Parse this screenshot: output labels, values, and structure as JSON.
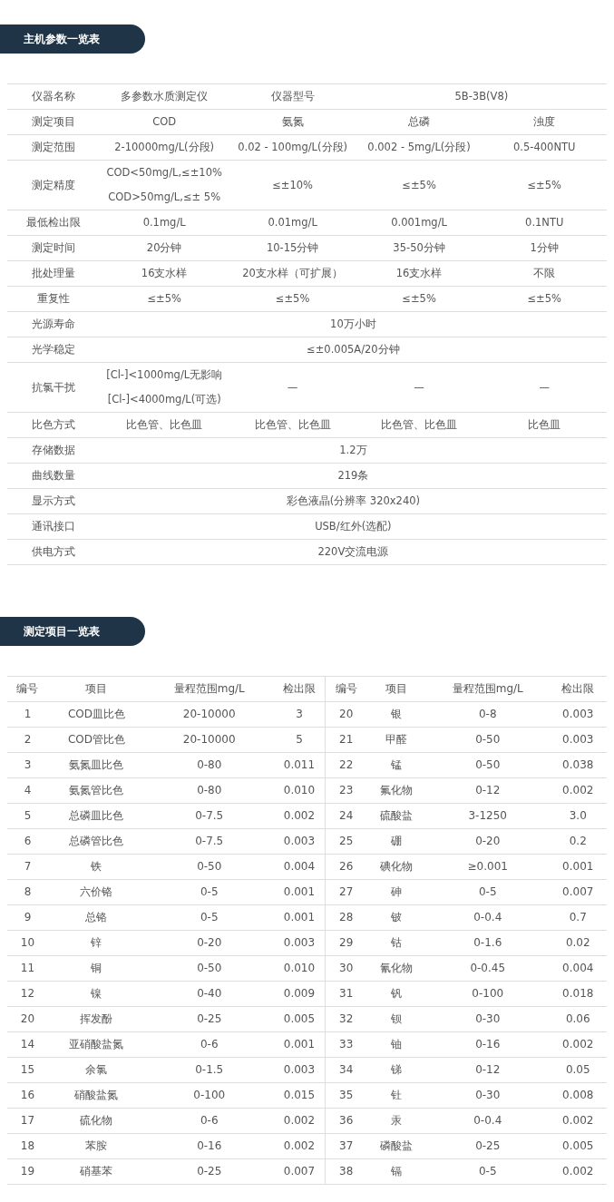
{
  "sections": [
    {
      "title": "主机参数一览表",
      "spec_rows": [
        {
          "label": "仪器名称",
          "cells": [
            [
              "多参数水质测定仪"
            ],
            [
              "仪器型号"
            ],
            [
              "5B-3B(V8)"
            ]
          ]
        },
        {
          "label": "测定项目",
          "cells": [
            [
              "COD"
            ],
            [
              "氨氮"
            ],
            [
              "总磷"
            ],
            [
              "浊度"
            ]
          ]
        },
        {
          "label": "测定范围",
          "cells": [
            [
              "2-10000mg/L(分段)"
            ],
            [
              "0.02 - 100mg/L(分段)"
            ],
            [
              "0.002 - 5mg/L(分段)"
            ],
            [
              "0.5-400NTU"
            ]
          ]
        },
        {
          "label": "测定精度",
          "cells": [
            [
              "COD<50mg/L,≤±10%",
              "COD>50mg/L,≤± 5%"
            ],
            [
              "≤±10%"
            ],
            [
              "≤±5%"
            ],
            [
              "≤±5%"
            ]
          ]
        },
        {
          "label": "最低检出限",
          "cells": [
            [
              "0.1mg/L"
            ],
            [
              "0.01mg/L"
            ],
            [
              "0.001mg/L"
            ],
            [
              "0.1NTU"
            ]
          ]
        },
        {
          "label": "测定时间",
          "cells": [
            [
              "20分钟"
            ],
            [
              "10-15分钟"
            ],
            [
              "35-50分钟"
            ],
            [
              "1分钟"
            ]
          ]
        },
        {
          "label": "批处理量",
          "cells": [
            [
              "16支水样"
            ],
            [
              "20支水样（可扩展）"
            ],
            [
              "16支水样"
            ],
            [
              "不限"
            ]
          ]
        },
        {
          "label": "重复性",
          "cells": [
            [
              "≤±5%"
            ],
            [
              "≤±5%"
            ],
            [
              "≤±5%"
            ],
            [
              "≤±5%"
            ]
          ]
        },
        {
          "label": "光源寿命",
          "cells": [
            [
              "10万小时"
            ]
          ]
        },
        {
          "label": "光学稳定",
          "cells": [
            [
              "≤±0.005A/20分钟"
            ]
          ]
        },
        {
          "label": "抗氯干扰",
          "cells": [
            [
              "[Cl-]<1000mg/L无影响",
              "[Cl-]<4000mg/L(可选)"
            ],
            [
              "—"
            ],
            [
              "—"
            ],
            [
              "—"
            ]
          ]
        },
        {
          "label": "比色方式",
          "cells": [
            [
              "比色管、比色皿"
            ],
            [
              "比色管、比色皿"
            ],
            [
              "比色管、比色皿"
            ],
            [
              "比色皿"
            ]
          ]
        },
        {
          "label": "存储数据",
          "cells": [
            [
              "1.2万"
            ]
          ]
        },
        {
          "label": "曲线数量",
          "cells": [
            [
              "219条"
            ]
          ]
        },
        {
          "label": "显示方式",
          "cells": [
            [
              "彩色液晶(分辨率 320x240)"
            ]
          ]
        },
        {
          "label": "通讯接口",
          "cells": [
            [
              "USB/红外(选配)"
            ]
          ]
        },
        {
          "label": "供电方式",
          "cells": [
            [
              "220V交流电源"
            ]
          ]
        }
      ]
    },
    {
      "title": "测定项目一览表",
      "columns": [
        "编号",
        "项目",
        "量程范围mg/L",
        "检出限",
        "编号",
        "项目",
        "量程范围mg/L",
        "检出限"
      ],
      "rows": [
        [
          "1",
          "COD皿比色",
          "20-10000",
          "3",
          "20",
          "银",
          "0-8",
          "0.003"
        ],
        [
          "2",
          "COD管比色",
          "20-10000",
          "5",
          "21",
          "甲醛",
          "0-50",
          "0.003"
        ],
        [
          "3",
          "氨氮皿比色",
          "0-80",
          "0.011",
          "22",
          "锰",
          "0-50",
          "0.038"
        ],
        [
          "4",
          "氨氮管比色",
          "0-80",
          "0.010",
          "23",
          "氟化物",
          "0-12",
          "0.002"
        ],
        [
          "5",
          "总磷皿比色",
          "0-7.5",
          "0.002",
          "24",
          "硫酸盐",
          "3-1250",
          "3.0"
        ],
        [
          "6",
          "总磷管比色",
          "0-7.5",
          "0.003",
          "25",
          "硼",
          "0-20",
          "0.2"
        ],
        [
          "7",
          "铁",
          "0-50",
          "0.004",
          "26",
          "碘化物",
          "≥0.001",
          "0.001"
        ],
        [
          "8",
          "六价铬",
          "0-5",
          "0.001",
          "27",
          "砷",
          "0-5",
          "0.007"
        ],
        [
          "9",
          "总铬",
          "0-5",
          "0.001",
          "28",
          "铍",
          "0-0.4",
          "0.7"
        ],
        [
          "10",
          "锌",
          "0-20",
          "0.003",
          "29",
          "钴",
          "0-1.6",
          "0.02"
        ],
        [
          "11",
          "铜",
          "0-50",
          "0.010",
          "30",
          "氰化物",
          "0-0.45",
          "0.004"
        ],
        [
          "12",
          "镍",
          "0-40",
          "0.009",
          "31",
          "钒",
          "0-100",
          "0.018"
        ],
        [
          "20",
          "挥发酚",
          "0-25",
          "0.005",
          "32",
          "钡",
          "0-30",
          "0.06"
        ],
        [
          "14",
          "亚硝酸盐氮",
          "0-6",
          "0.001",
          "33",
          "铀",
          "0-16",
          "0.002"
        ],
        [
          "15",
          "余氯",
          "0-1.5",
          "0.003",
          "34",
          "锑",
          "0-12",
          "0.05"
        ],
        [
          "16",
          "硝酸盐氮",
          "0-100",
          "0.015",
          "35",
          "钍",
          "0-30",
          "0.008"
        ],
        [
          "17",
          "硫化物",
          "0-6",
          "0.002",
          "36",
          "汞",
          "0-0.4",
          "0.002"
        ],
        [
          "18",
          "苯胺",
          "0-16",
          "0.002",
          "37",
          "磷酸盐",
          "0-25",
          "0.005"
        ],
        [
          "19",
          "硝基苯",
          "0-25",
          "0.007",
          "38",
          "镉",
          "0-5",
          "0.002"
        ]
      ]
    }
  ]
}
